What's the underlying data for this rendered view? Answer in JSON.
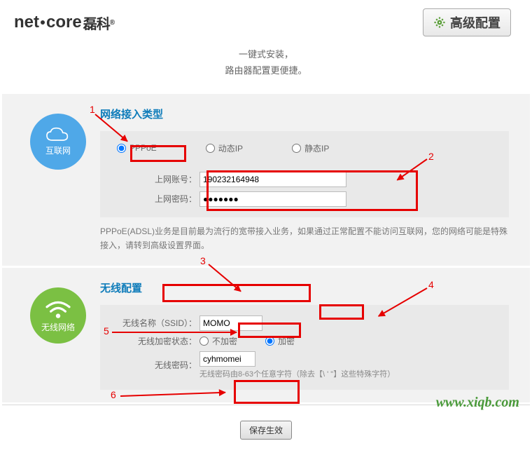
{
  "header": {
    "brand_prefix": "net",
    "brand_suffix": "core",
    "brand_cn": "磊科",
    "advanced_button": "高级配置"
  },
  "subtitle_line1": "一键式安装，",
  "subtitle_line2": "路由器配置更便捷。",
  "network": {
    "icon_label": "互联网",
    "section_title": "网络接入类型",
    "radio_pppoe": "PPPoE",
    "radio_dynip": "动态IP",
    "radio_static": "静态IP",
    "account_label": "上网账号：",
    "account_value": "190232164948",
    "password_label": "上网密码：",
    "password_value": "●●●●●●●",
    "description": "PPPoE(ADSL)业务是目前最为流行的宽带接入业务，如果通过正常配置不能访问互联网，您的网络可能是特殊接入，请转到高级设置界面。"
  },
  "wireless": {
    "icon_label": "无线网络",
    "section_title": "无线配置",
    "ssid_label": "无线名称（SSID）：",
    "ssid_value": "MOMO",
    "enc_state_label": "无线加密状态：",
    "enc_off": "不加密",
    "enc_on": "加密",
    "password_label": "无线密码：",
    "password_value": "cyhmomei",
    "password_hint": "无线密码由8-63个任意字符（除去【\\ ' \"】这些特殊字符）"
  },
  "footer": {
    "save_button": "保存生效"
  },
  "watermark": "www.xiqb.com",
  "annotations": {
    "n1": "1",
    "n2": "2",
    "n3": "3",
    "n4": "4",
    "n5": "5",
    "n6": "6"
  }
}
